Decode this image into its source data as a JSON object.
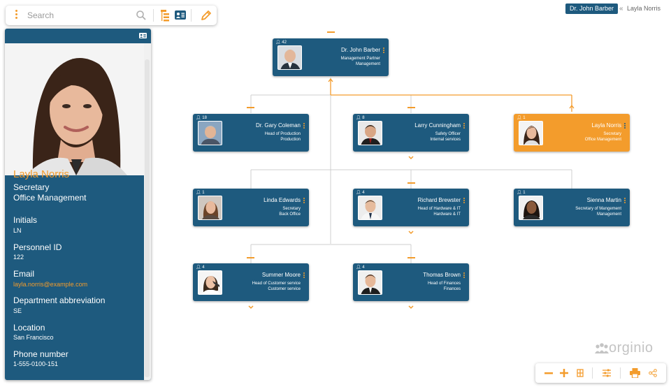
{
  "colors": {
    "brand_blue": "#1e5a7e",
    "accent_orange": "#f39c2c",
    "connector": "#cfcfcf",
    "active_connector": "#f39c2c"
  },
  "toolbar": {
    "search_placeholder": "Search",
    "icons": [
      "more-vertical-icon",
      "search-icon",
      "hierarchy-icon",
      "id-card-icon",
      "pencil-icon"
    ]
  },
  "breadcrumb": {
    "root": "Dr. John Barber",
    "separator": "«",
    "current": "Layla Norris"
  },
  "profile": {
    "name": "Layla Norris",
    "title": "Secretary",
    "department": "Office Management",
    "fields": [
      {
        "label": "Initials",
        "value": "LN"
      },
      {
        "label": "Personnel ID",
        "value": "122"
      },
      {
        "label": "Email",
        "value": "layla.norris@example.com"
      },
      {
        "label": "Department abbreviation",
        "value": "SE"
      },
      {
        "label": "Location",
        "value": "San Francisco"
      },
      {
        "label": "Phone number",
        "value": "1-555-0100-151"
      }
    ]
  },
  "org_chart": {
    "nodes": [
      {
        "id": "barber",
        "count": "42",
        "name": "Dr. John Barber",
        "role": "Management Partner",
        "dept": "Management",
        "active": false
      },
      {
        "id": "coleman",
        "count": "18",
        "name": "Dr. Gary Coleman",
        "role": "Head of Production",
        "dept": "Production",
        "active": false
      },
      {
        "id": "cunningham",
        "count": "8",
        "name": "Larry Cunningham",
        "role": "Safety Officer",
        "dept": "Internal services",
        "active": false
      },
      {
        "id": "norris",
        "count": "1",
        "name": "Layla Norris",
        "role": "Secretary",
        "dept": "Office Management",
        "active": true
      },
      {
        "id": "edwards",
        "count": "1",
        "name": "Linda Edwards",
        "role": "Secretary",
        "dept": "Back Office",
        "active": false
      },
      {
        "id": "brewster",
        "count": "4",
        "name": "Richard Brewster",
        "role": "Head of Hardware & IT",
        "dept": "Hardware & IT",
        "active": false
      },
      {
        "id": "martin",
        "count": "1",
        "name": "Sienna Martin",
        "role": "Secretary of Mangement",
        "dept": "Management",
        "active": false
      },
      {
        "id": "moore",
        "count": "4",
        "name": "Summer Moore",
        "role": "Head of Customer service",
        "dept": "Customer service",
        "active": false
      },
      {
        "id": "brown",
        "count": "4",
        "name": "Thomas Brown",
        "role": "Head of Finances",
        "dept": "Finances",
        "active": false
      }
    ]
  },
  "bottom_toolbar": {
    "icons": [
      "zoom-out-icon",
      "zoom-in-icon",
      "fit-icon",
      "settings-sliders-icon",
      "print-icon",
      "share-icon"
    ]
  },
  "logo": {
    "text": "orginio"
  }
}
